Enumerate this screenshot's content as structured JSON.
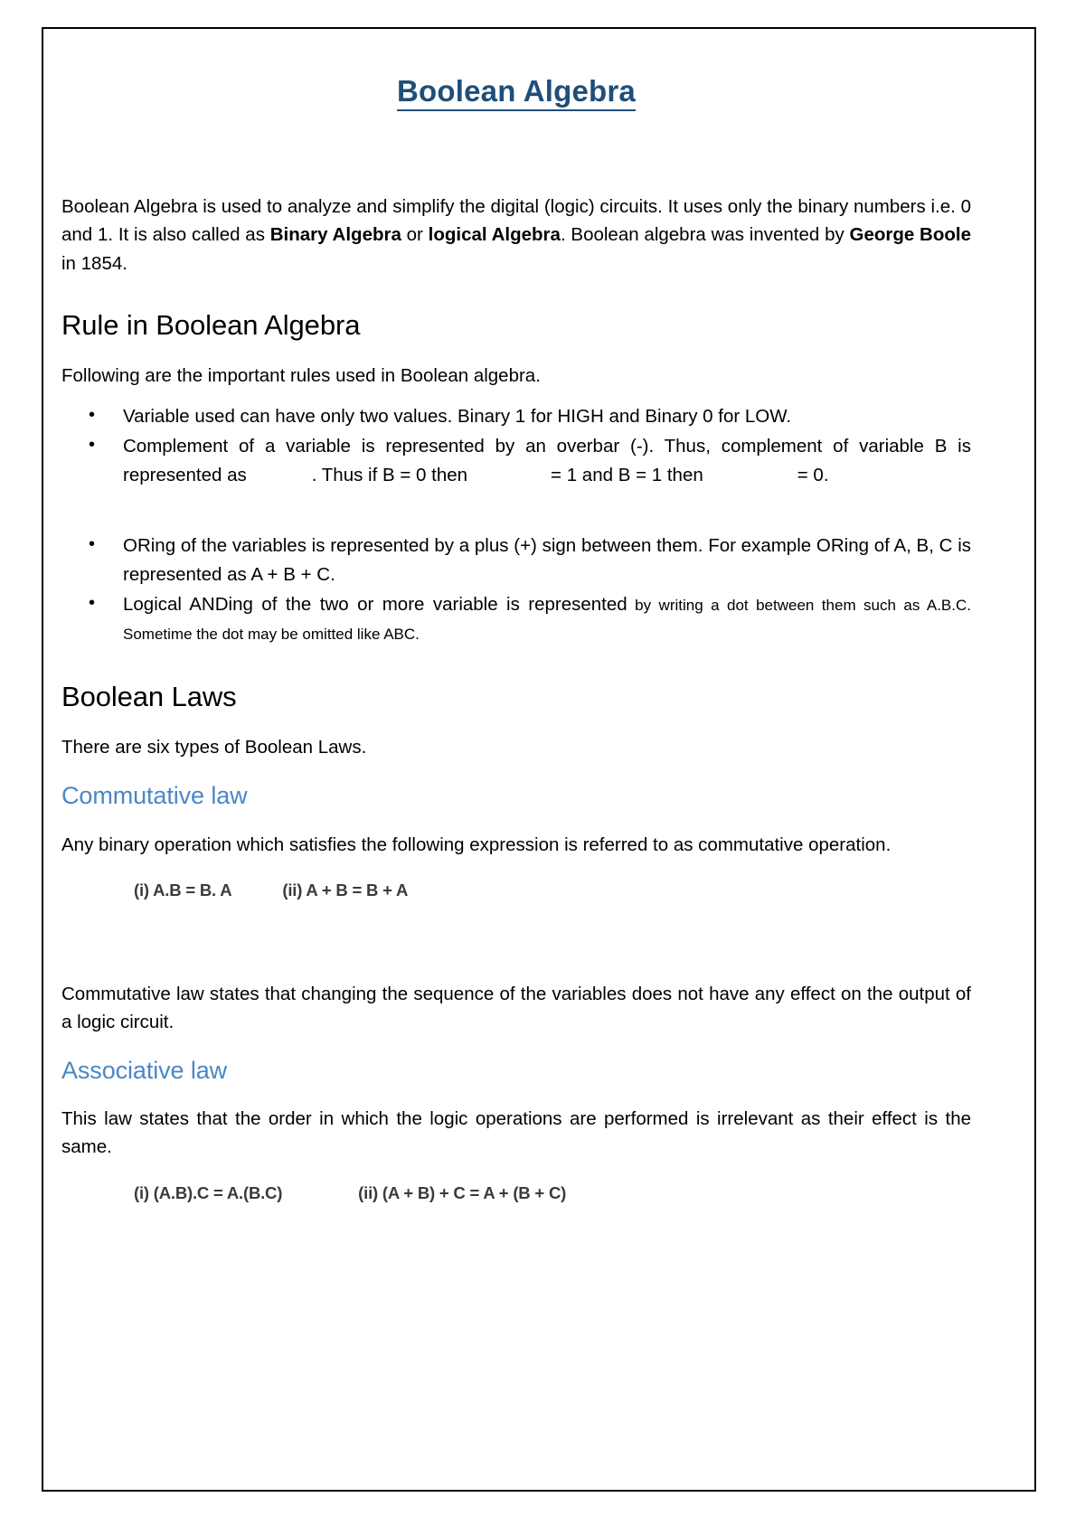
{
  "document": {
    "title": "Boolean Algebra",
    "intro": {
      "part1": "Boolean Algebra is used to analyze and simplify the digital (logic) circuits. It uses only the binary numbers i.e. 0 and 1. It is also called as ",
      "bold1": "Binary Algebra",
      "part2": " or ",
      "bold2": "logical Algebra",
      "part3": ". Boolean algebra was invented by ",
      "bold3": "George Boole",
      "part4": " in 1854."
    },
    "section_rule": {
      "heading": "Rule in Boolean Algebra",
      "lead": "Following are the important rules used in Boolean algebra.",
      "bullets": [
        {
          "id": "bullet-variable-values",
          "text": "Variable used can have only two values. Binary 1 for HIGH and Binary 0 for LOW."
        },
        {
          "id": "bullet-complement",
          "seg1": "Complement of a variable is represented by an overbar (-). Thus, complement of variable B is represented as",
          "seg2": ". Thus if B = 0 then",
          "seg3": "= 1 and B = 1 then",
          "seg4": "= 0."
        },
        {
          "id": "bullet-oring",
          "text": "ORing of the variables is represented by a plus (+) sign between them. For example ORing of A, B, C is represented as A + B + C."
        },
        {
          "id": "bullet-anding",
          "big": "Logical ANDing of the two or more variable is represented",
          "small": " by writing a dot between them such as A.B.C. Sometime the dot may be omitted like ABC."
        }
      ]
    },
    "section_laws": {
      "heading": "Boolean Laws",
      "lead": "There are six types of Boolean Laws.",
      "commutative": {
        "heading": "Commutative law",
        "intro": "Any binary operation which satisfies the following expression is referred to as commutative operation.",
        "formula_i": "(i) A.B = B. A",
        "formula_ii": "(ii) A + B = B + A",
        "closing": "Commutative law states that changing the sequence of the variables does not have any effect on the output of a logic circuit."
      },
      "associative": {
        "heading": "Associative law",
        "intro": "This law states that the order in which the logic operations are performed is irrelevant as their effect is the same.",
        "formula_i": "(i) (A.B).C = A.(B.C)",
        "formula_ii": "(ii) (A + B) + C = A + (B + C)"
      }
    },
    "colors": {
      "title": "#1F4E79",
      "subheading_blue": "#4A86C8",
      "body": "#000000",
      "formula": "#3A3A3A",
      "page_border": "#000000"
    }
  }
}
